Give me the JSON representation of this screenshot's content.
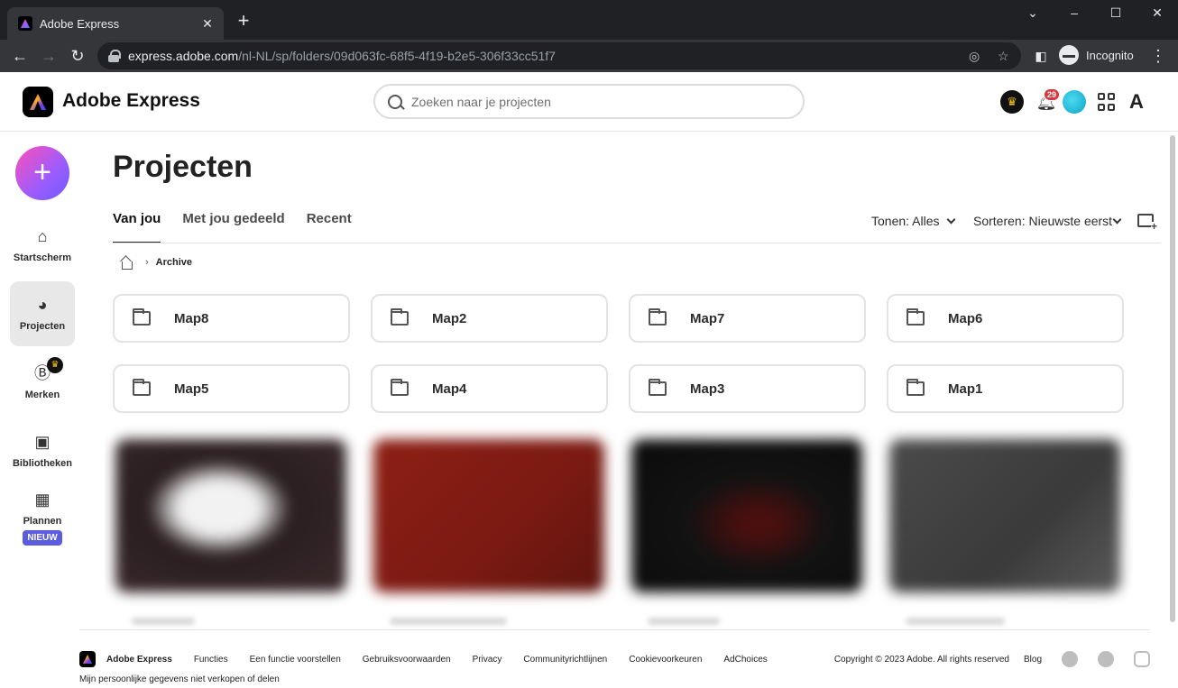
{
  "browser": {
    "tab_title": "Adobe Express",
    "url_host": "express.adobe.com",
    "url_path": "/nl-NL/sp/folders/09d063fc-68f5-4f19-b2e5-306f33cc51f7",
    "profile_label": "Incognito"
  },
  "header": {
    "brand": "Adobe Express",
    "search_placeholder": "Zoeken naar je projecten",
    "notification_count": "29"
  },
  "rail": {
    "create_label": "+",
    "items": [
      {
        "label": "Startscherm"
      },
      {
        "label": "Projecten"
      },
      {
        "label": "Merken"
      },
      {
        "label": "Bibliotheken"
      },
      {
        "label": "Plannen",
        "badge": "NIEUW"
      }
    ]
  },
  "main": {
    "title": "Projecten",
    "tabs": [
      {
        "label": "Van jou"
      },
      {
        "label": "Met jou gedeeld"
      },
      {
        "label": "Recent"
      }
    ],
    "filter_label": "Tonen: Alles",
    "sort_label": "Sorteren: Nieuwste eerst",
    "breadcrumb": "Archive",
    "folders": [
      "Map8",
      "Map2",
      "Map7",
      "Map6",
      "Map5",
      "Map4",
      "Map3",
      "Map1"
    ]
  },
  "footer": {
    "brand": "Adobe Express",
    "links": [
      "Functies",
      "Een functie voorstellen",
      "Gebruiksvoorwaarden",
      "Privacy",
      "Communityrichtlijnen",
      "Cookievoorkeuren",
      "AdChoices"
    ],
    "copyright": "Copyright © 2023 Adobe. All rights reserved",
    "blog": "Blog",
    "privacy_note": "Mijn persoonlijke gegevens niet verkopen of delen"
  }
}
